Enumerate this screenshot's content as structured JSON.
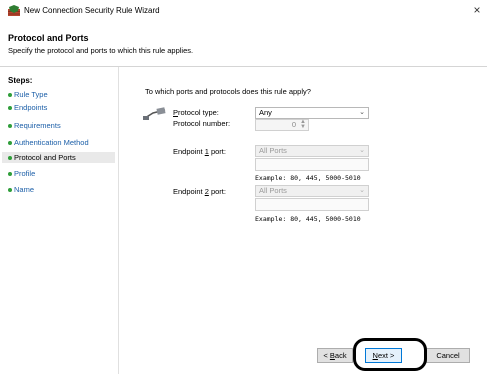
{
  "window": {
    "title": "New Connection Security Rule Wizard",
    "close_icon": "×"
  },
  "header": {
    "title": "Protocol and Ports",
    "subtitle": "Specify the protocol and ports to which this rule applies."
  },
  "sidebar": {
    "title": "Steps:",
    "items": [
      {
        "label": "Rule Type"
      },
      {
        "label": "Endpoints"
      },
      {
        "label": "Requirements"
      },
      {
        "label": "Authentication Method"
      },
      {
        "label": "Protocol and Ports",
        "active": true
      },
      {
        "label": "Profile"
      },
      {
        "label": "Name"
      }
    ]
  },
  "main": {
    "question": "To which ports and protocols does this rule apply?",
    "protocol_type": {
      "label_prefix": "P",
      "label_rest": "rotocol type:",
      "value": "Any"
    },
    "protocol_number": {
      "label": "Protocol number:",
      "value": "0"
    },
    "endpoint1": {
      "label_prefix": "Endpoint ",
      "label_key": "1",
      "label_suffix": " port:",
      "value": "All Ports",
      "example": "Example: 80, 445, 5000-5010"
    },
    "endpoint2": {
      "label_prefix": "Endpoint ",
      "label_key": "2",
      "label_suffix": " port:",
      "value": "All Ports",
      "example": "Example: 80, 445, 5000-5010"
    }
  },
  "buttons": {
    "back": {
      "prefix": "< ",
      "key": "B",
      "rest": "ack"
    },
    "next": {
      "key": "N",
      "rest": "ext >"
    },
    "cancel": "Cancel"
  },
  "colors": {
    "link": "#1c5fa8",
    "step_dot": "#2f9e3a",
    "default_button_border": "#0078d7"
  },
  "icons": {
    "app": "firewall-shield-icon",
    "protocol": "network-cable-icon",
    "close": "close-icon"
  }
}
